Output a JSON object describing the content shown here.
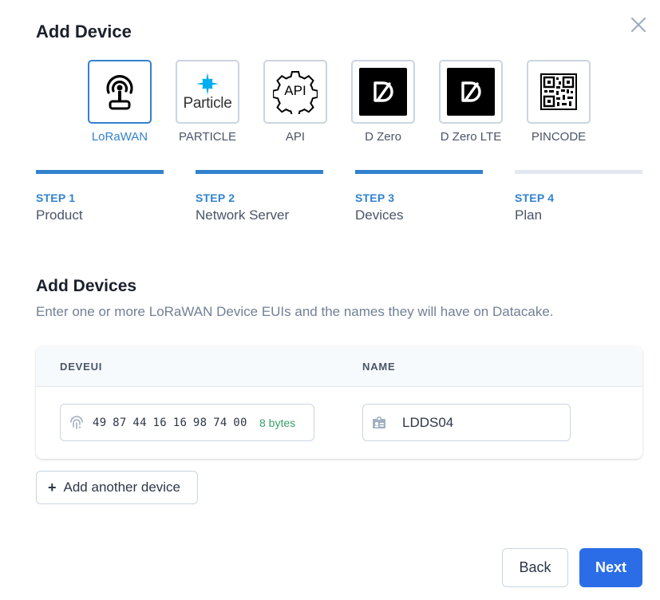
{
  "modal": {
    "title": "Add Device",
    "close_icon": "close-icon"
  },
  "device_types": [
    {
      "label": "LoRaWAN",
      "icon": "lorawan-antenna-icon",
      "selected": true
    },
    {
      "label": "PARTICLE",
      "icon": "particle-logo-icon",
      "logo_text": "Particle",
      "selected": false
    },
    {
      "label": "API",
      "icon": "api-gear-icon",
      "icon_text": "API",
      "selected": false
    },
    {
      "label": "D Zero",
      "icon": "dzero-logo-icon",
      "selected": false
    },
    {
      "label": "D Zero LTE",
      "icon": "dzero-logo-icon",
      "selected": false
    },
    {
      "label": "PINCODE",
      "icon": "qr-code-icon",
      "selected": false
    }
  ],
  "steps": [
    {
      "number": "STEP 1",
      "name": "Product",
      "status": "complete"
    },
    {
      "number": "STEP 2",
      "name": "Network Server",
      "status": "complete"
    },
    {
      "number": "STEP 3",
      "name": "Devices",
      "status": "current"
    },
    {
      "number": "STEP 4",
      "name": "Plan",
      "status": "pending"
    }
  ],
  "section": {
    "title": "Add Devices",
    "description": "Enter one or more LoRaWAN Device EUIs and the names they will have on Datacake."
  },
  "table": {
    "columns": [
      "DEVEUI",
      "NAME"
    ],
    "rows": [
      {
        "deveui": "49 87 44 16 16 98 74 00",
        "byte_count": "8 bytes",
        "name": "LDDS04"
      }
    ]
  },
  "buttons": {
    "add_icon": "+",
    "add_another": "Add another device",
    "back": "Back",
    "next": "Next"
  },
  "colors": {
    "accent": "#3182ce",
    "primary_button": "#2b6de6",
    "success": "#38a169",
    "step_pending": "#e2e8f0"
  }
}
